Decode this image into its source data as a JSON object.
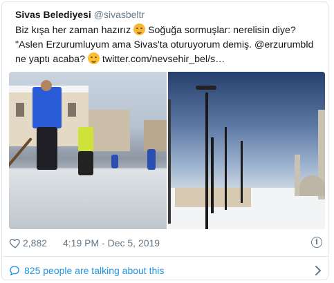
{
  "tweet": {
    "author_name": "Sivas Belediyesi",
    "author_handle": "@sivasbeltr",
    "text_line1_a": "Biz kışa her zaman hazırız",
    "text_line1_b": "Soğuğa sormuşlar: nerelisin diye?",
    "text_line2": "\"Aslen Erzurumluyum ama Sivas'ta oturuyorum demiş. @erzurumbld",
    "text_line3_a": "ne yaptı acaba?",
    "text_line3_link": "twitter.com/nevsehir_bel/s…"
  },
  "icons": {
    "emoji_1": "smiling-face-with-smiling-eyes-icon",
    "emoji_2": "smiling-face-icon",
    "like": "heart-icon",
    "info": "info-icon",
    "conversation": "speech-bubble-icon",
    "more": "chevron-right-icon"
  },
  "footer": {
    "likes": "2,882",
    "timestamp": "4:19 PM - Dec 5, 2019",
    "info_symbol": "i"
  },
  "conversation": {
    "label": "825 people are talking about this"
  },
  "colors": {
    "accent": "#1b95e0",
    "text": "#14171a",
    "muted": "#657786",
    "border": "#e1e8ed"
  }
}
